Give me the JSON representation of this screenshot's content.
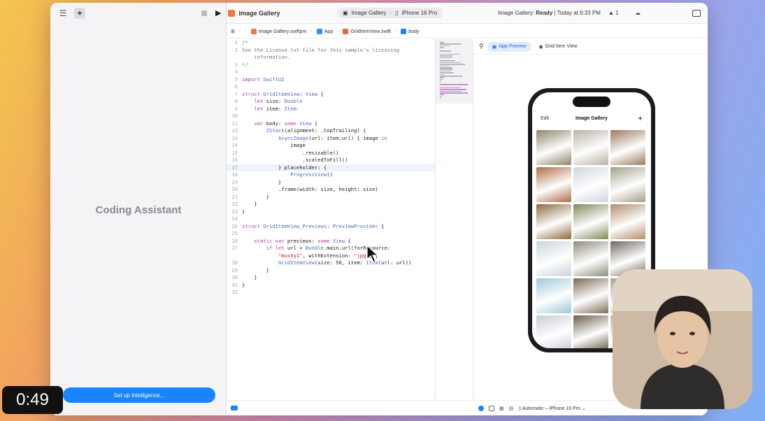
{
  "assistant": {
    "title": "Coding Assistant",
    "setup_button": "Set up Intelligence..."
  },
  "toolbar": {
    "project": "Image Gallery",
    "scheme_target": "Image Gallery",
    "scheme_device": "iPhone 16 Pro",
    "status_prefix": "Image Gallery: ",
    "status_state": "Ready",
    "status_suffix": " | Today at 6:33 PM",
    "warnings": "1"
  },
  "breadcrumb": {
    "items": [
      "Image Gallery.swiftpm",
      "App",
      "GridItemView.swift",
      "body"
    ]
  },
  "code_lines": [
    {
      "n": "1",
      "t": "/*"
    },
    {
      "n": "2",
      "t": "See the License.txt file for this sample's licensing"
    },
    {
      "n": "",
      "t": "    information."
    },
    {
      "n": "3",
      "t": "*/"
    },
    {
      "n": "4",
      "t": ""
    },
    {
      "n": "5",
      "t": "import SwiftUI"
    },
    {
      "n": "6",
      "t": ""
    },
    {
      "n": "7",
      "t": "struct GridItemView: View {"
    },
    {
      "n": "8",
      "t": "    let size: Double"
    },
    {
      "n": "9",
      "t": "    let item: Item"
    },
    {
      "n": "10",
      "t": ""
    },
    {
      "n": "11",
      "t": "    var body: some View {"
    },
    {
      "n": "12",
      "t": "        ZStack(alignment: .topTrailing) {"
    },
    {
      "n": "13",
      "t": "            AsyncImage(url: item.url) { image in"
    },
    {
      "n": "14",
      "t": "                image"
    },
    {
      "n": "15",
      "t": "                    .resizable()"
    },
    {
      "n": "16",
      "t": "                    .scaledToFill()"
    },
    {
      "n": "17",
      "t": "            } placeholder: {"
    },
    {
      "n": "18",
      "t": "                ProgressView()"
    },
    {
      "n": "19",
      "t": "            }"
    },
    {
      "n": "20",
      "t": "            .frame(width: size, height: size)"
    },
    {
      "n": "21",
      "t": "        }"
    },
    {
      "n": "22",
      "t": "    }"
    },
    {
      "n": "23",
      "t": "}"
    },
    {
      "n": "24",
      "t": ""
    },
    {
      "n": "26",
      "t": "struct GridItemView_Previews: PreviewProvider {"
    },
    {
      "n": "25",
      "t": ""
    },
    {
      "n": "26",
      "t": "    static var previews: some View {"
    },
    {
      "n": "27",
      "t": "        if let url = Bundle.main.url(forResource:"
    },
    {
      "n": "",
      "t": "            \"mushy1\", withExtension: \"jpg\") {"
    },
    {
      "n": "28",
      "t": "            GridItemView(size: 50, item: Item(url: url))"
    },
    {
      "n": "29",
      "t": "        }"
    },
    {
      "n": "30",
      "t": "    }"
    },
    {
      "n": "31",
      "t": "}"
    },
    {
      "n": "32",
      "t": ""
    }
  ],
  "canvas": {
    "app_preview_tab": "App Preview",
    "grid_item_tab": "Grid Item View",
    "device_selector": "Automatic – iPhone 16 Pro",
    "phone": {
      "nav_edit": "Edit",
      "nav_title": "Image Gallery",
      "nav_add": "+"
    }
  },
  "photo_tiles": [
    "#8d8367",
    "#b9b1a3",
    "#9a7a5c",
    "#b06b44",
    "#cfd6dc",
    "#a3a089",
    "#8c6a3e",
    "#7f8a5a",
    "#b08d6f",
    "#c9d2da",
    "#8f8d7e",
    "#6e6a5d",
    "#9cc9d9",
    "#7d6b55",
    "#a7a29a",
    "#c8cdd3",
    "#6b5d4b",
    "#bfb6a8"
  ],
  "timer": "0:49"
}
